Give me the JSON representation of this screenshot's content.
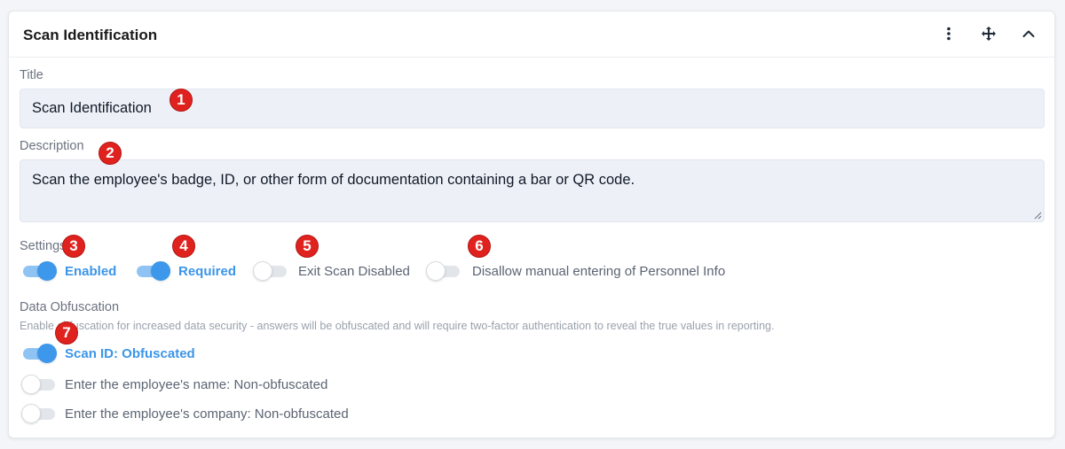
{
  "header": {
    "title": "Scan Identification",
    "icons": [
      "more-vertical-icon",
      "move-icon",
      "chevron-up-icon"
    ]
  },
  "title_field": {
    "label": "Title",
    "value": "Scan Identification"
  },
  "description_field": {
    "label": "Description",
    "value": "Scan the employee's badge, ID, or other form of documentation containing a bar or QR code."
  },
  "settings": {
    "label": "Settings",
    "toggles": [
      {
        "label": "Enabled",
        "on": true
      },
      {
        "label": "Required",
        "on": true
      },
      {
        "label": "Exit Scan Disabled",
        "on": false
      },
      {
        "label": "Disallow manual entering of Personnel Info",
        "on": false
      }
    ]
  },
  "obfuscation": {
    "label": "Data Obfuscation",
    "helper": "Enable obfuscation for increased data security - answers will be obfuscated and will require two-factor authentication to reveal the true values in reporting.",
    "toggles": [
      {
        "label": "Scan ID: Obfuscated",
        "on": true
      },
      {
        "label": "Enter the employee's name: Non-obfuscated",
        "on": false
      },
      {
        "label": "Enter the employee's company: Non-obfuscated",
        "on": false
      }
    ]
  },
  "annotations": [
    "1",
    "2",
    "3",
    "4",
    "5",
    "6",
    "7"
  ],
  "colors": {
    "accent": "#3d97ea",
    "accent_light": "#8ec3f4",
    "badge": "#e0221f",
    "input_bg": "#edf1f7"
  }
}
